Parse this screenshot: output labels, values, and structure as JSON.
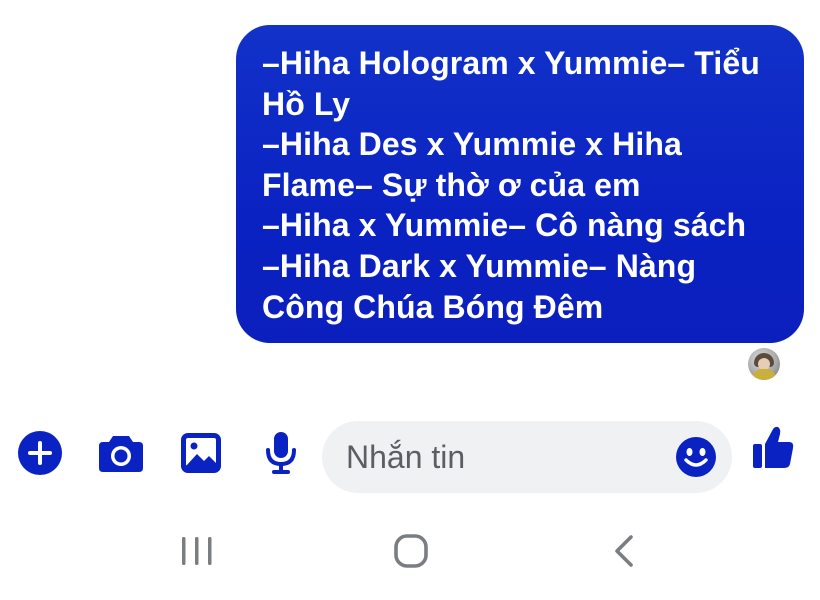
{
  "conversation": {
    "sent_message": {
      "lines": [
        "–Hiha Hologram x Yummie– Tiểu",
        "Hồ Ly",
        "–Hiha Des x Yummie x Hiha",
        "Flame– Sự thờ ơ của em",
        "–Hiha x Yummie–  Cô nàng sách",
        "–Hiha Dark x Yummie– Nàng",
        "Công Chúa Bóng Đêm"
      ],
      "bubble_color": "#0a22c2",
      "status_indicator": "seen-by-avatar"
    }
  },
  "composer": {
    "placeholder": "Nhắn tin",
    "value": "",
    "accent_color": "#0a22c2",
    "icons": [
      "plus-icon",
      "camera-icon",
      "image-icon",
      "microphone-icon",
      "emoji-icon",
      "thumbs-up-icon"
    ]
  },
  "system_nav": {
    "icons": [
      "recent-apps-icon",
      "home-icon",
      "back-icon"
    ],
    "color": "#7a7d82"
  }
}
